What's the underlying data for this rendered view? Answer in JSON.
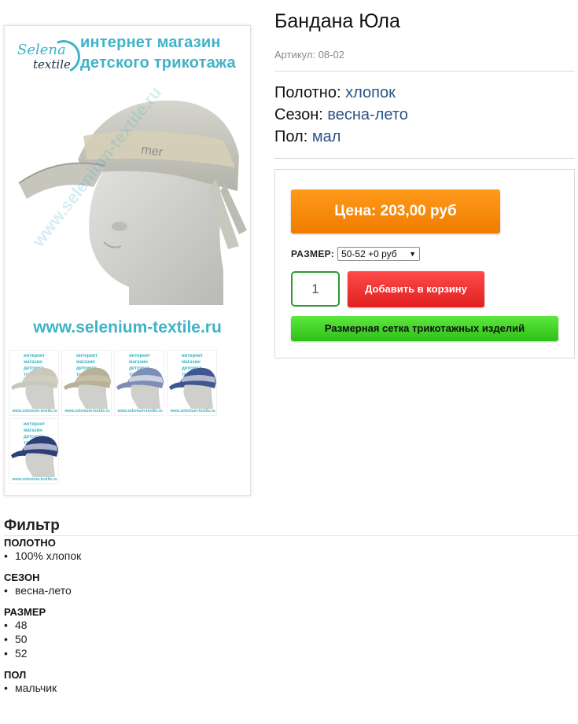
{
  "gallery": {
    "brand_name": "Selena",
    "brand_sub": "textile",
    "shop_title_line1": "интернет магазин",
    "shop_title_line2": "детского трикотажа",
    "site_url": "www.selenium-textile.ru",
    "cap_label": "mer",
    "thumbnails": [
      {
        "cap_color": "#c9c8bd",
        "band_color": "#d8d3c0"
      },
      {
        "cap_color": "#b8b19a",
        "band_color": "#cfc7ae"
      },
      {
        "cap_color": "#7d8db5",
        "band_color": "#ffffff"
      },
      {
        "cap_color": "#3f5690",
        "band_color": "#ffffff"
      },
      {
        "cap_color": "#2d3f78",
        "band_color": "#ffffff"
      }
    ]
  },
  "product": {
    "title": "Бандана Юла",
    "sku": "Артикул: 08-02",
    "attributes": [
      {
        "label": "Полотно:",
        "value": "хлопок"
      },
      {
        "label": "Сезон:",
        "value": "весна-лето"
      },
      {
        "label": "Пол:",
        "value": "мал"
      }
    ]
  },
  "buy": {
    "price": "Цена: 203,00 руб",
    "size_label": "РАЗМЕР:",
    "size_selected": "50-52 +0 руб",
    "quantity": "1",
    "add_to_cart": "Добавить в корзину",
    "size_chart": "Размерная сетка трикотажных изделий"
  },
  "filter": {
    "title": "Фильтр",
    "groups": [
      {
        "title": "ПОЛОТНО",
        "items": [
          "100% хлопок"
        ]
      },
      {
        "title": "СЕЗОН",
        "items": [
          "весна-лето"
        ]
      },
      {
        "title": "РАЗМЕР",
        "items": [
          "48",
          "50",
          "52"
        ]
      },
      {
        "title": "ПОЛ",
        "items": [
          "мальчик"
        ]
      }
    ]
  },
  "colors": {
    "accent": "#3fb3c7",
    "price_button": "#f68b0a",
    "cart_button": "#ee3030",
    "size_chart_button": "#44d42a",
    "link_value": "#2b5286"
  }
}
